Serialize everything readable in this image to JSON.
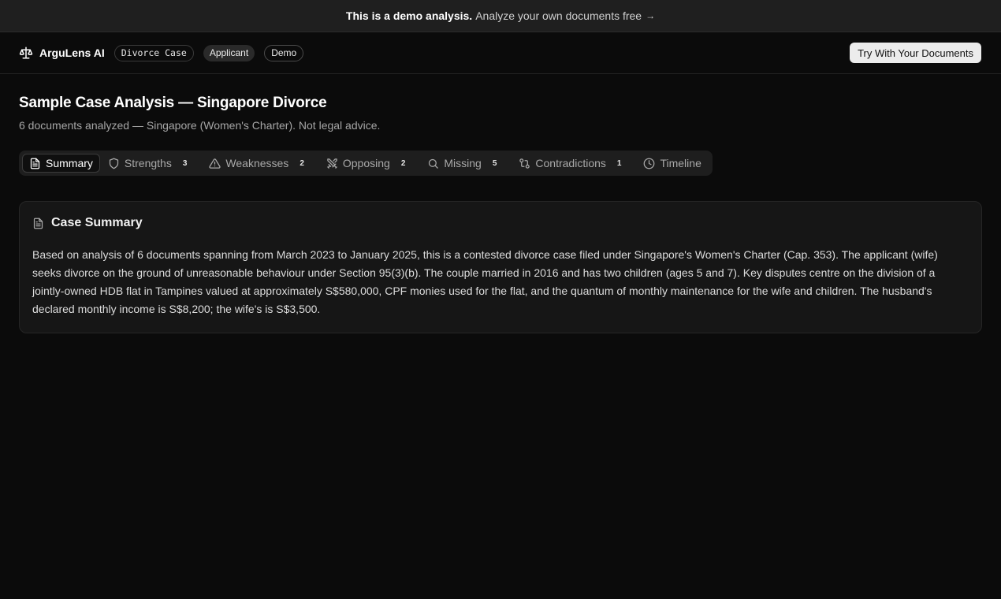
{
  "banner": {
    "bold": "This is a demo analysis.",
    "text": "Analyze your own documents free",
    "arrow": "→"
  },
  "header": {
    "brand": "ArguLens AI",
    "case_chip": "Divorce Case",
    "role_chip": "Applicant",
    "demo_chip": "Demo",
    "cta": "Try With Your Documents"
  },
  "page": {
    "title": "Sample Case Analysis — Singapore Divorce",
    "subtitle": "6 documents analyzed — Singapore (Women's Charter). Not legal advice."
  },
  "tabs": [
    {
      "label": "Summary",
      "icon": "document-icon",
      "active": true
    },
    {
      "label": "Strengths",
      "icon": "shield-icon",
      "count": "3"
    },
    {
      "label": "Weaknesses",
      "icon": "warning-icon",
      "count": "2"
    },
    {
      "label": "Opposing",
      "icon": "swords-icon",
      "count": "2"
    },
    {
      "label": "Missing",
      "icon": "search-icon",
      "count": "5"
    },
    {
      "label": "Contradictions",
      "icon": "git-compare-icon",
      "count": "1"
    },
    {
      "label": "Timeline",
      "icon": "clock-icon"
    }
  ],
  "summary": {
    "title": "Case Summary",
    "body": "Based on analysis of 6 documents spanning from March 2023 to January 2025, this is a contested divorce case filed under Singapore's Women's Charter (Cap. 353). The applicant (wife) seeks divorce on the ground of unreasonable behaviour under Section 95(3)(b). The couple married in 2016 and has two children (ages 5 and 7). Key disputes centre on the division of a jointly-owned HDB flat in Tampines valued at approximately S$580,000, CPF monies used for the flat, and the quantum of monthly maintenance for the wife and children. The husband's declared monthly income is S$8,200; the wife's is S$3,500."
  },
  "colors": {
    "background": "#0b0b0b",
    "card": "#161616",
    "banner": "#1f1f1f",
    "cta": "#ececec"
  }
}
